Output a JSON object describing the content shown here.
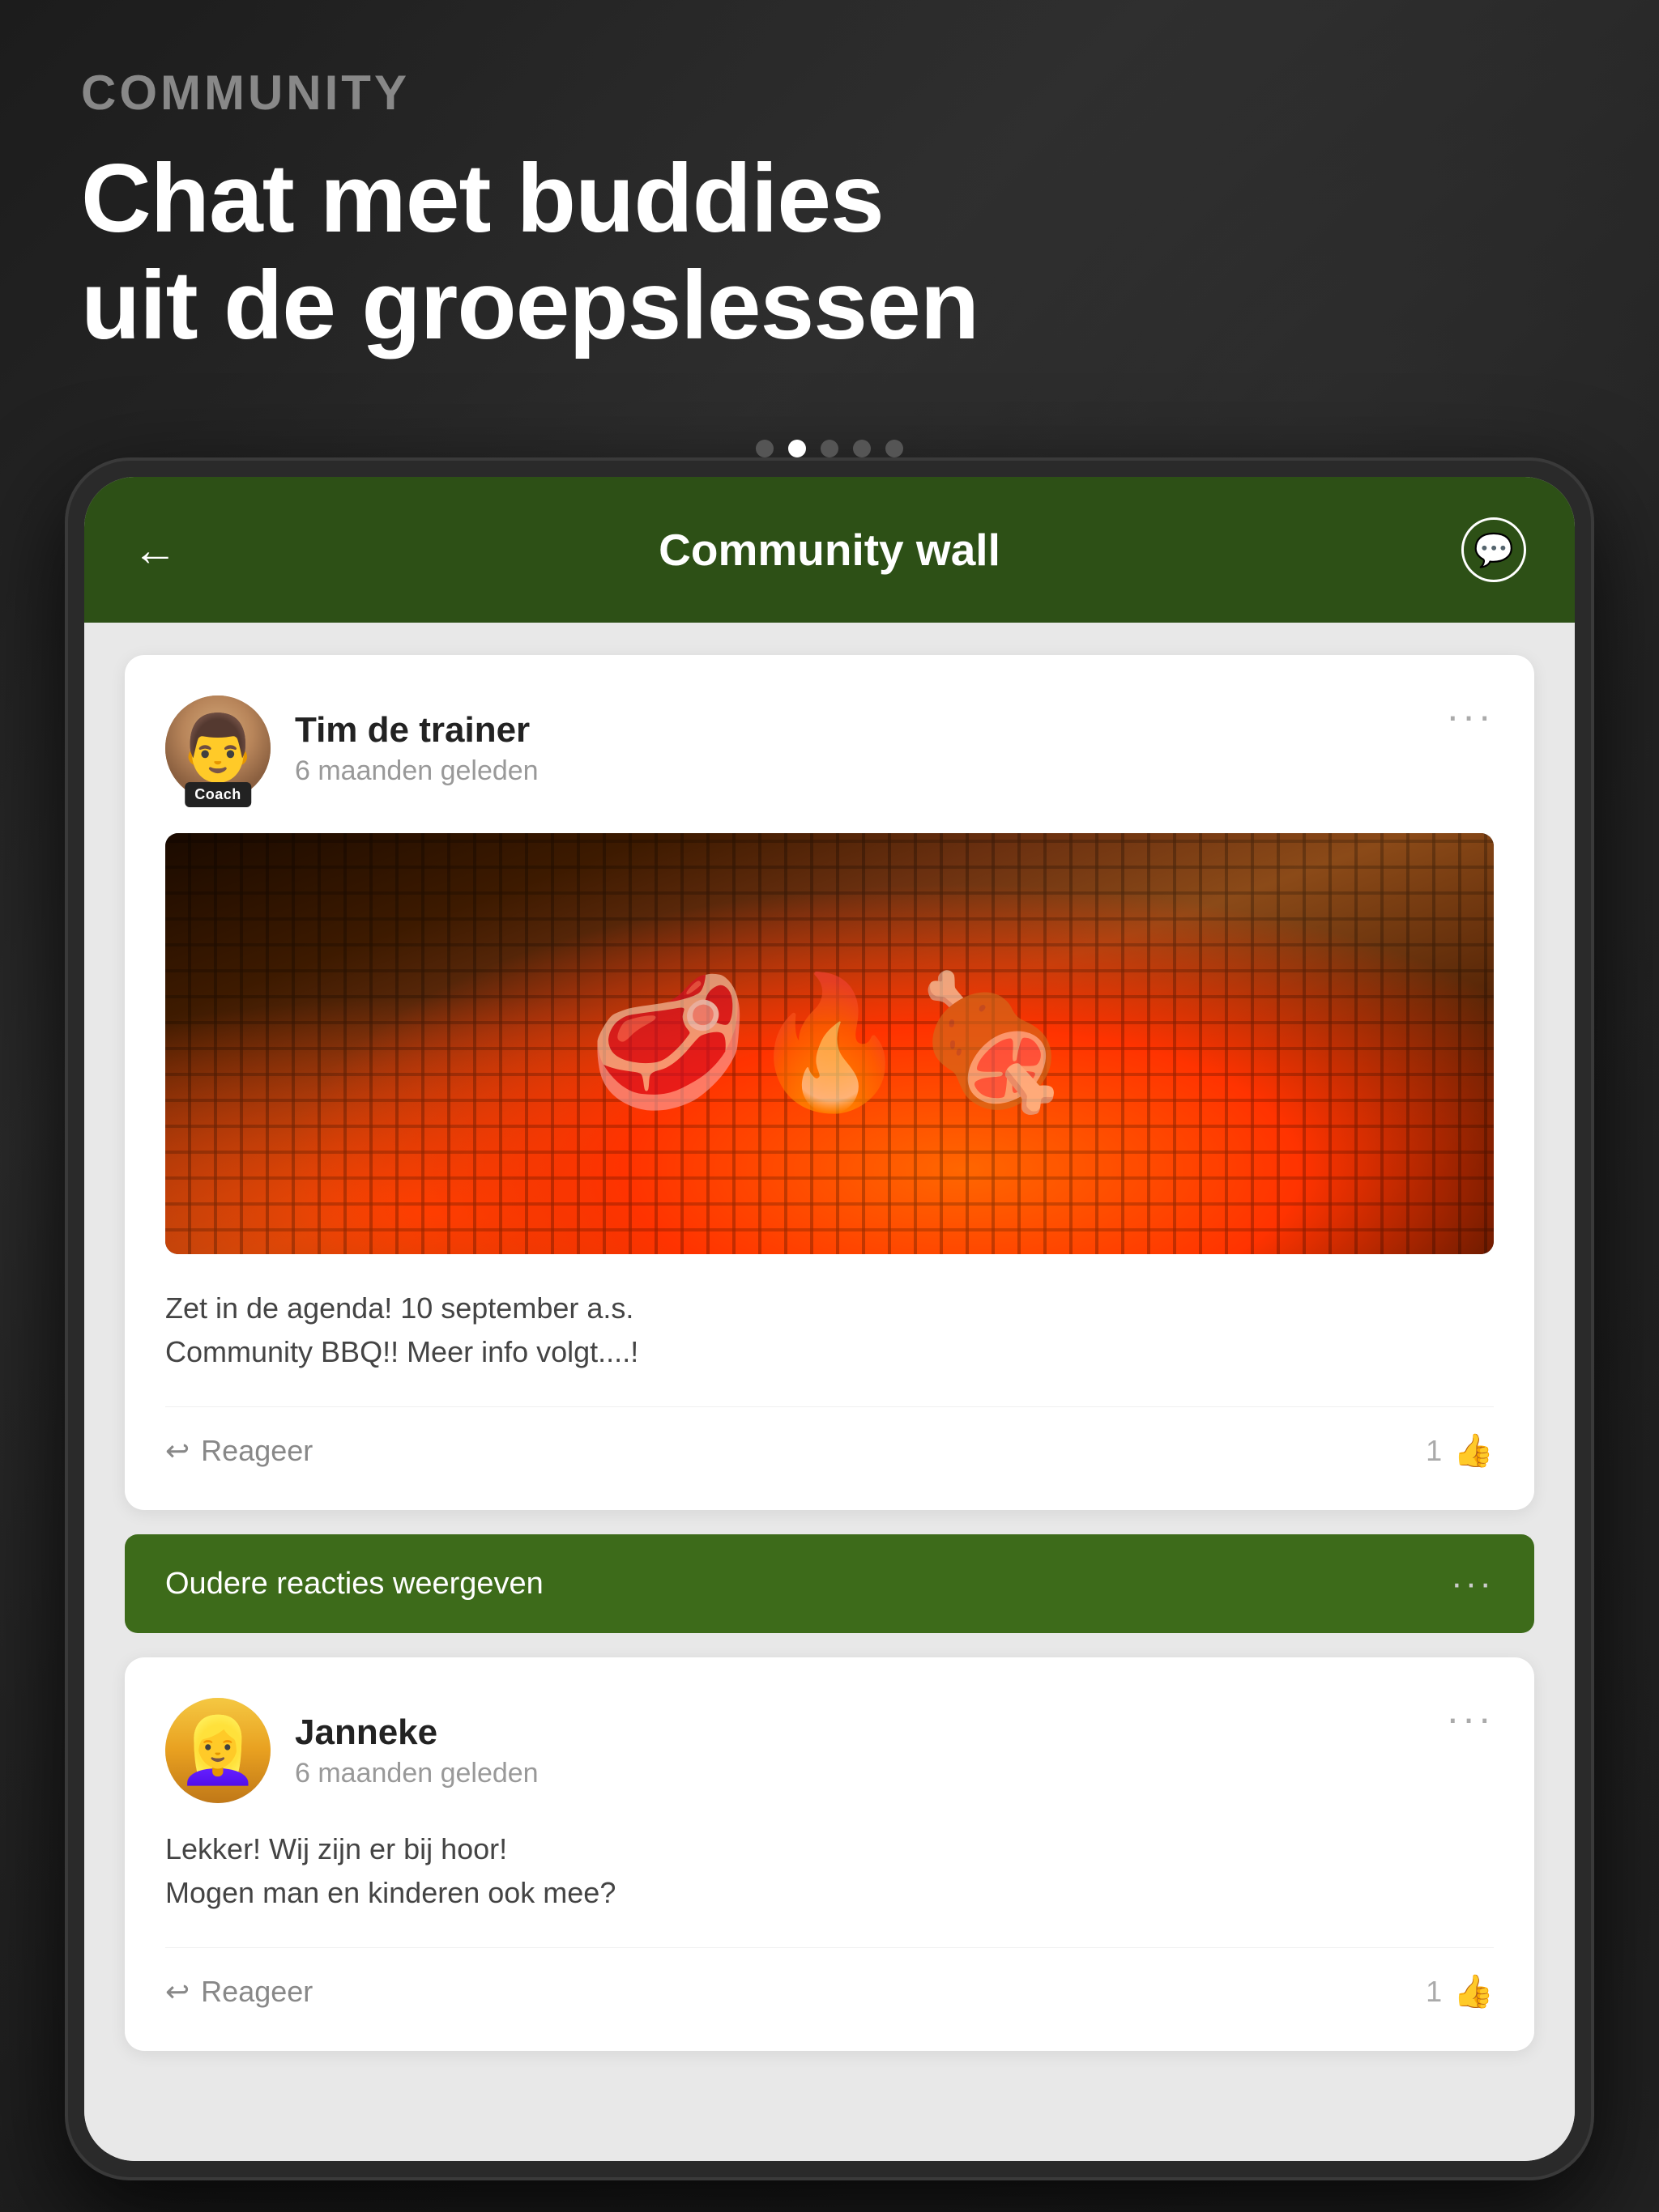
{
  "background": {
    "color": "#1a1a1a"
  },
  "top_section": {
    "section_label": "COMMUNITY",
    "main_heading_line1": "Chat met buddies",
    "main_heading_line2": "uit de groepslessen"
  },
  "pagination": {
    "dots": [
      {
        "active": false
      },
      {
        "active": true
      },
      {
        "active": false
      },
      {
        "active": false
      },
      {
        "active": false
      }
    ]
  },
  "app": {
    "header": {
      "back_label": "←",
      "title": "Community wall",
      "chat_icon": "💬"
    },
    "post": {
      "author_name": "Tim de trainer",
      "post_time": "6 maanden geleden",
      "coach_badge": "Coach",
      "more_btn": "···",
      "post_text_line1": "Zet in de agenda! 10 september a.s.",
      "post_text_line2": "Community BBQ!! Meer info volgt....!",
      "reply_label": "Reageer",
      "like_count": "1"
    },
    "older_bar": {
      "label": "Oudere reacties weergeven",
      "more_btn": "···"
    },
    "comment": {
      "author_name": "Janneke",
      "post_time": "6 maanden geleden",
      "more_btn": "···",
      "text_line1": "Lekker! Wij zijn er bij hoor!",
      "text_line2": "Mogen man en kinderen ook mee?",
      "reply_label": "Reageer",
      "like_count": "1"
    }
  }
}
